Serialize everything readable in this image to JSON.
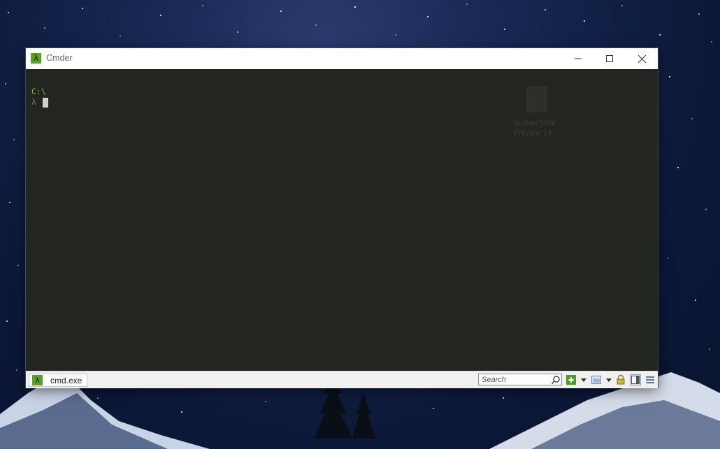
{
  "window": {
    "title": "Cmder",
    "app_icon_glyph": "λ",
    "controls": [
      "minimize-icon",
      "maximize-icon",
      "close-icon"
    ]
  },
  "console": {
    "path_line": "C:\\",
    "prompt_symbol": "λ"
  },
  "desktop_icon": {
    "label_line1": "ScreenToGif -",
    "label_line2": "Preview 14 ..."
  },
  "status_bar": {
    "tab": {
      "icon_glyph": "λ",
      "label": "cmd.exe"
    },
    "search": {
      "placeholder": "Search"
    },
    "buttons": [
      "new-console-icon",
      "dropdown-arrow-icon",
      "split-view-icon",
      "dropdown-arrow-icon",
      "lock-icon",
      "panel-view-icon",
      "menu-icon"
    ]
  },
  "colors": {
    "console_bg": "#232521",
    "prompt_path": "#8fb24b",
    "app_icon_green": "#5c9f2a"
  }
}
